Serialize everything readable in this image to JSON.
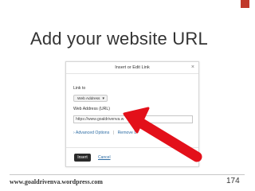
{
  "slide": {
    "title": "Add your website URL",
    "footer_url": "www.goaldrivenva.wordpress.com",
    "page_number": "174",
    "accent_color": "#c0392b",
    "arrow_color": "#e3101a"
  },
  "dialog": {
    "title": "Insert or Edit Link",
    "close_icon": "×",
    "link_to_label": "Link to",
    "link_type_selected": "Web Address",
    "url_label": "Web Address (URL)",
    "url_value": "https://www.goaldrivenva.w",
    "advanced_options": "Advanced Options",
    "remove_link": "Remove L",
    "insert_label": "Insert",
    "cancel_label": "Cancel"
  }
}
